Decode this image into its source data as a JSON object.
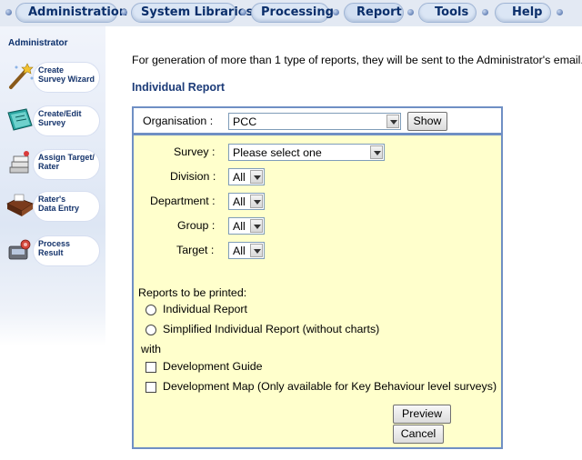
{
  "nav": {
    "items": [
      {
        "label": "Administration"
      },
      {
        "label": "System Libraries"
      },
      {
        "label": "Processing"
      },
      {
        "label": "Report"
      },
      {
        "label": "Tools"
      },
      {
        "label": "Help"
      }
    ]
  },
  "sidebar": {
    "title": "Administrator",
    "items": [
      {
        "label": "Create\nSurvey Wizard",
        "icon": "magic-wand-icon"
      },
      {
        "label": "Create/Edit\nSurvey",
        "icon": "survey-folder-icon"
      },
      {
        "label": "Assign Target/\nRater",
        "icon": "assign-stack-icon"
      },
      {
        "label": "Rater's\nData Entry",
        "icon": "data-entry-icon"
      },
      {
        "label": "Process\nResult",
        "icon": "process-result-icon"
      }
    ]
  },
  "main": {
    "info_text": "For generation of more than 1 type of reports, they will be sent to the Administrator's email.",
    "heading": "Individual Report",
    "organisation": {
      "label": "Organisation :",
      "value": "PCC",
      "show_button": "Show"
    },
    "fields": {
      "survey": {
        "label": "Survey :",
        "value": "Please select one"
      },
      "division": {
        "label": "Division :",
        "value": "All"
      },
      "department": {
        "label": "Department :",
        "value": "All"
      },
      "group": {
        "label": "Group :",
        "value": "All"
      },
      "target": {
        "label": "Target :",
        "value": "All"
      }
    },
    "reports_label": "Reports to be printed:",
    "report_options": [
      {
        "label": "Individual Report",
        "selected": false
      },
      {
        "label": "Simplified Individual Report (without charts)",
        "selected": false
      }
    ],
    "with_label": "with",
    "extras": [
      {
        "label": "Development Guide",
        "checked": false
      },
      {
        "label": "Development Map (Only available for Key Behaviour level surveys)",
        "checked": false
      }
    ],
    "preview_button": "Preview",
    "cancel_button": "Cancel"
  }
}
